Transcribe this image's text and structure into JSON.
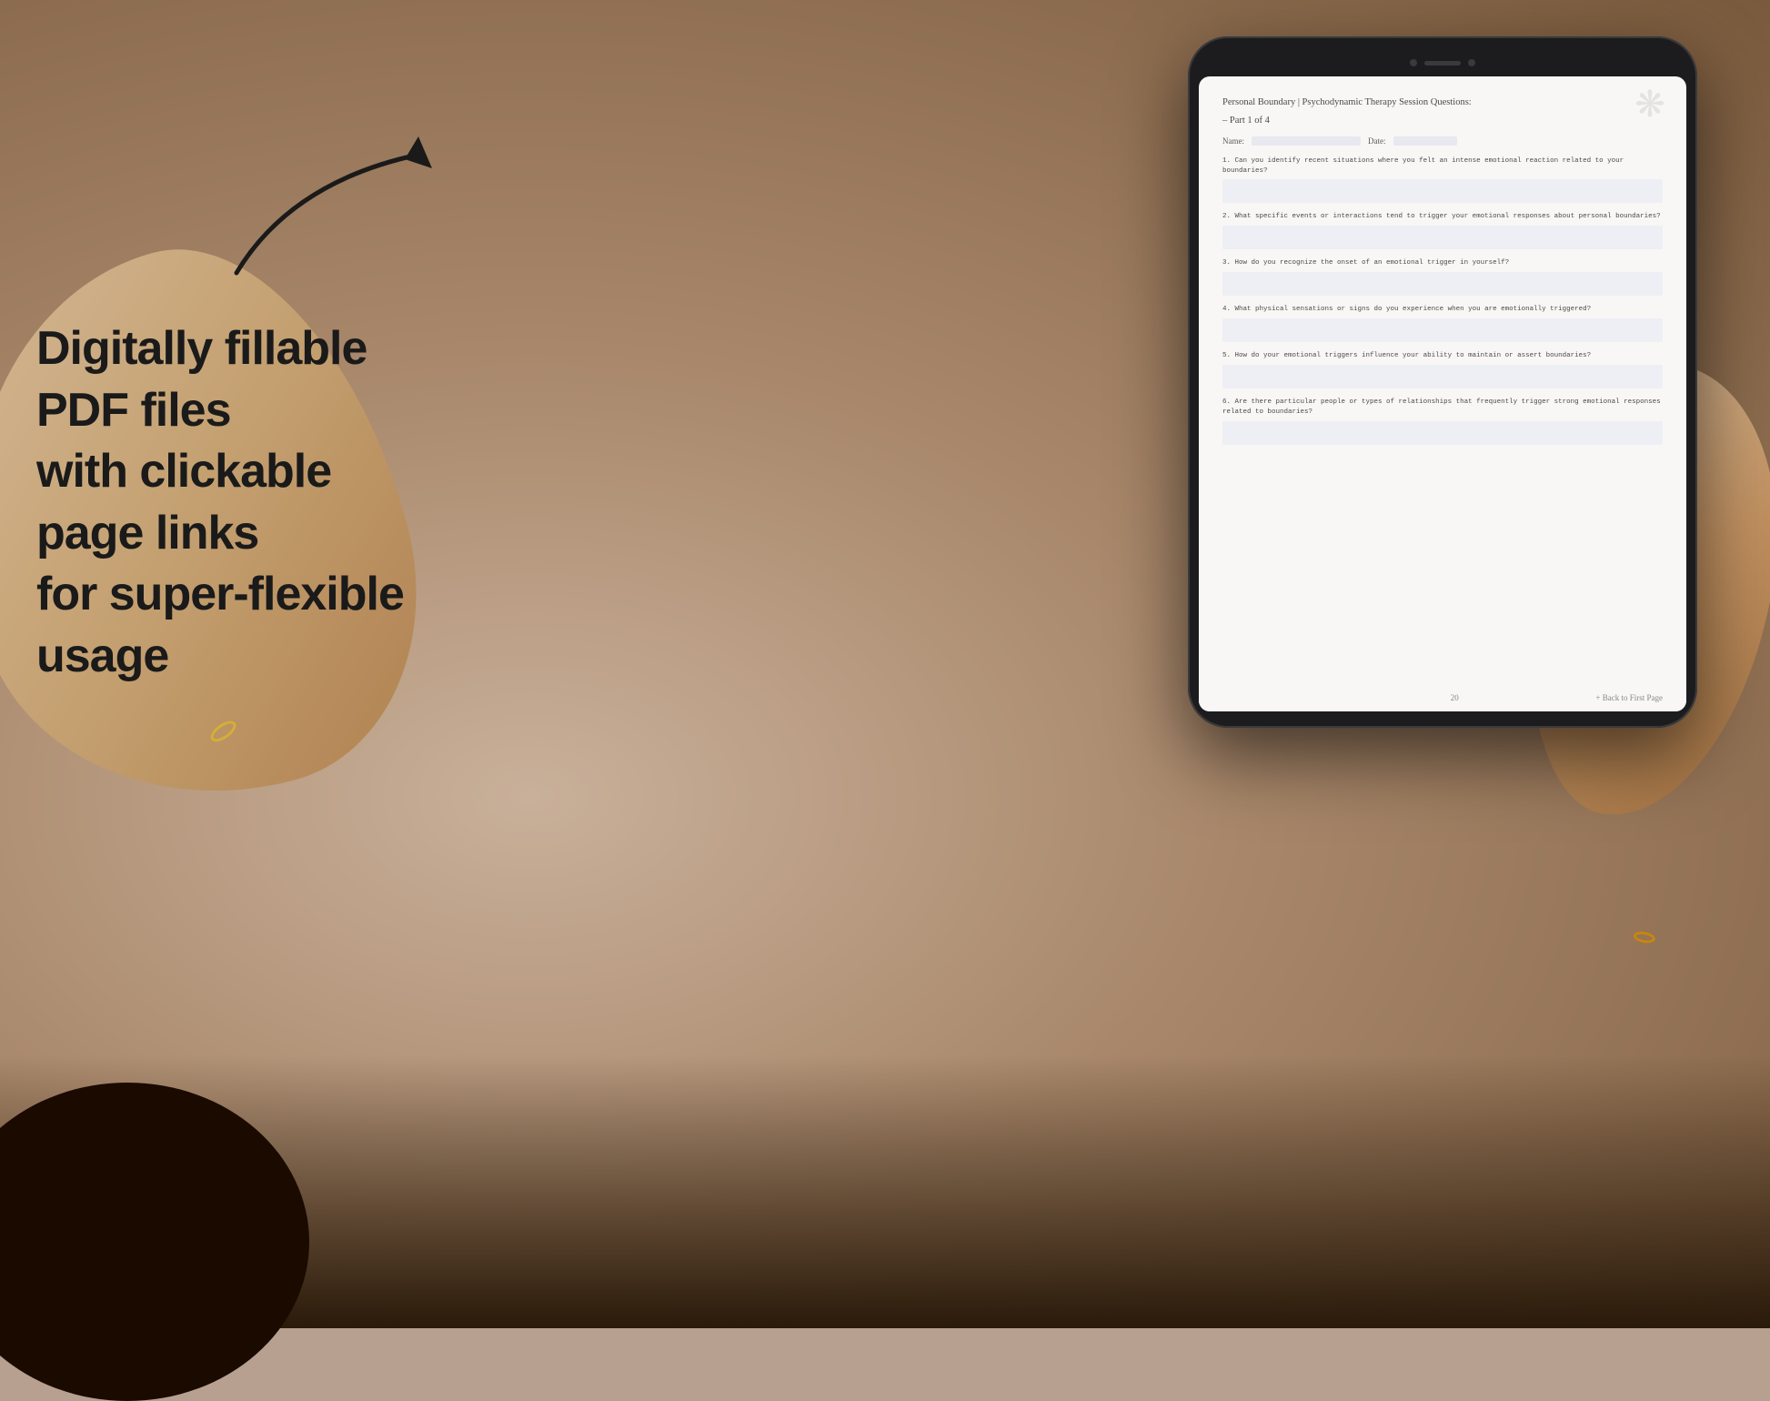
{
  "background": {
    "color_main": "#b8a090",
    "color_dark": "#2a1a0a"
  },
  "left_text": {
    "line1": "Digitally fillable PDF files",
    "line2": "with clickable page links",
    "line3": "for super-flexible usage"
  },
  "arrow": {
    "label": "arrow pointing to tablet"
  },
  "tablet": {
    "camera_label": "camera",
    "speaker_label": "speaker"
  },
  "pdf": {
    "title": "Personal Boundary | Psychodynamic Therapy Session Questions:",
    "subtitle": "– Part 1 of 4",
    "name_label": "Name:",
    "date_label": "Date:",
    "questions": [
      {
        "number": "1.",
        "text": "Can you identify recent situations where you felt an intense emotional reaction related to your boundaries?"
      },
      {
        "number": "2.",
        "text": "What specific events or interactions tend to trigger your emotional responses about personal boundaries?"
      },
      {
        "number": "3.",
        "text": "How do you recognize the onset of an emotional trigger in yourself?"
      },
      {
        "number": "4.",
        "text": "What physical sensations or signs do you experience when you are emotionally triggered?"
      },
      {
        "number": "5.",
        "text": "How do your emotional triggers influence your ability to maintain or assert boundaries?"
      },
      {
        "number": "6.",
        "text": "Are there particular people or types of relationships that frequently trigger strong emotional responses related to boundaries?"
      }
    ],
    "footer": {
      "page_number": "20",
      "back_link": "+ Back to First Page"
    }
  }
}
